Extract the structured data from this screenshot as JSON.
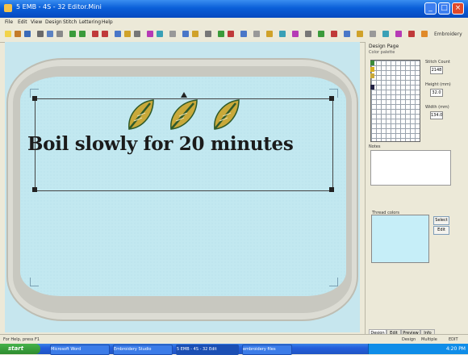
{
  "window": {
    "title": "5 EMB - 4S - 32 Editor.Mini",
    "min": "_",
    "max": "□",
    "close": "×"
  },
  "menu": [
    "File",
    "Edit",
    "View",
    "Design",
    "Stitch",
    "Lettering",
    "Help"
  ],
  "toolbar": {
    "dropdown_label": "Embroidery"
  },
  "design": {
    "text": "Boil slowly for 20 minutes"
  },
  "panel": {
    "title": "Design Page",
    "subtitle": "Color palette",
    "field_labels": [
      "Stitch Count",
      "Height (mm)",
      "Width (mm)"
    ],
    "field_values": [
      "2148",
      "32.0",
      "134.0"
    ],
    "notes_label": "Notes",
    "preview_label": "Thread colors",
    "buttons": [
      "Select",
      "Edit"
    ],
    "tabs": [
      "Design",
      "Edit",
      "Preview",
      "Info"
    ]
  },
  "status": {
    "left": "For Help, press F1",
    "right": [
      "Design",
      "Multiple",
      "EDIT"
    ]
  },
  "taskbar": {
    "start": "start",
    "tasks": [
      "Microsoft Word",
      "Embroidery Studio",
      "5 EMB - 4S - 32 Edit",
      "embroidery files"
    ],
    "clock": "4:20 PM"
  },
  "colors": {
    "accent": "#0a5fd8",
    "fabric": "#c2e8f0",
    "leaf": "#c9a93a",
    "leaf_stroke": "#2f5a2a"
  }
}
